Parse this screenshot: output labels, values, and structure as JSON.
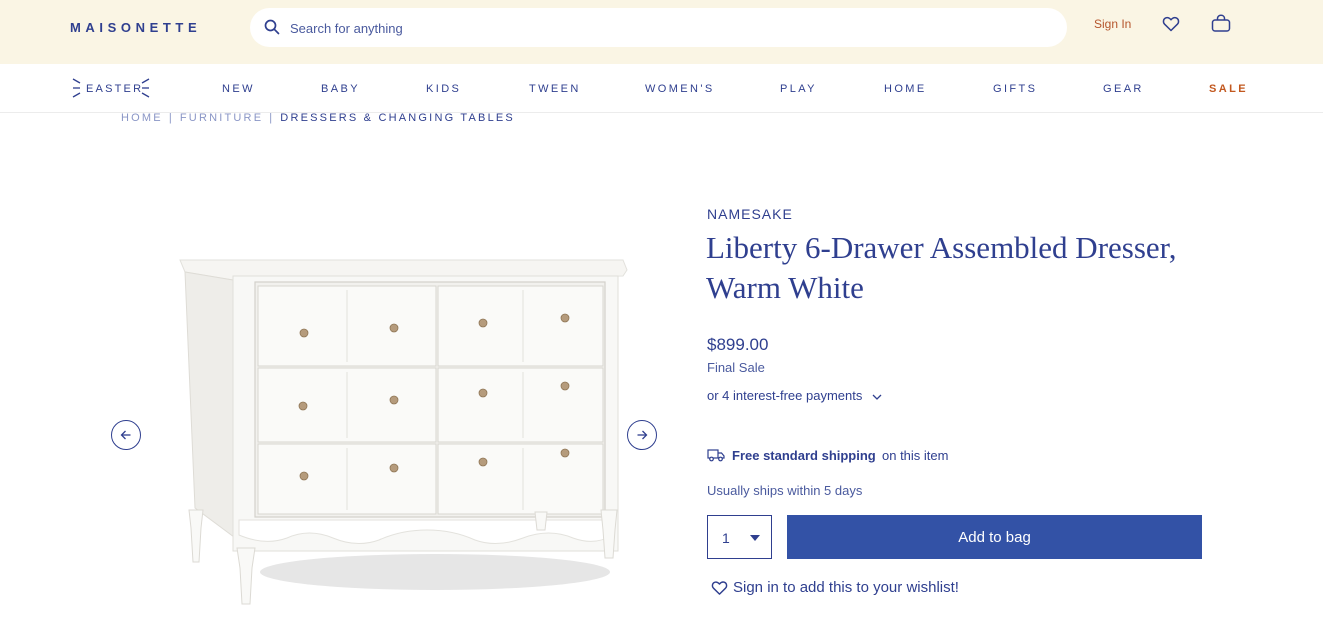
{
  "header": {
    "logo": "MAISONETTE",
    "search_placeholder": "Search for anything",
    "sign_in": "Sign In"
  },
  "nav": {
    "easter": "EASTER",
    "items": [
      "NEW",
      "BABY",
      "KIDS",
      "TWEEN",
      "WOMEN'S",
      "PLAY",
      "HOME",
      "GIFTS",
      "GEAR",
      "SALE"
    ]
  },
  "breadcrumb": [
    "HOME",
    "FURNITURE",
    "DRESSERS & CHANGING TABLES"
  ],
  "product": {
    "brand": "NAMESAKE",
    "title": "Liberty 6-Drawer Assembled Dresser, Warm White",
    "price": "$899.00",
    "final_sale": "Final Sale",
    "installments": "or 4 interest-free payments",
    "shipping_bold": "Free standard shipping",
    "shipping_rest": "on this item",
    "ships_within": "Usually ships within 5 days",
    "quantity": "1",
    "add_to_bag": "Add to bag",
    "wishlist": "Sign in to add this to your wishlist!"
  },
  "colors": {
    "navy": "#2f3f8f",
    "topbar_bg": "#faf5e4",
    "button_blue": "#3352a6",
    "sale_orange": "#c2581f"
  },
  "icons": [
    "search-icon",
    "heart-icon",
    "bag-icon",
    "arrow-left-icon",
    "arrow-right-icon",
    "chevron-down-icon",
    "truck-icon"
  ]
}
